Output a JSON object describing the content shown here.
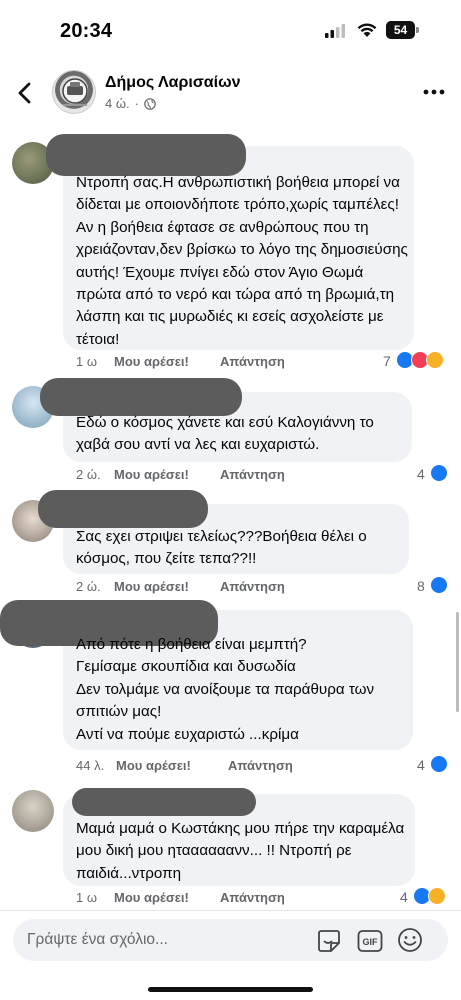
{
  "status_bar": {
    "time": "20:34",
    "battery": "54",
    "battery_level": 0.54
  },
  "header": {
    "page_name": "Δήμος Λαρισαίων",
    "post_age": "4 ώ."
  },
  "comments": [
    {
      "text": "Ντροπή σας.Η ανθρωπιστική βοήθεια μπορεί να δίδεται με οποιονδήποτε τρόπο,χωρίς ταμπέλες! Αν η βοήθεια έφτασε σε ανθρώπους που τη χρειάζονταν,δεν βρίσκω το λόγο της δημοσιεύσης αυτής! Έχουμε πνίγει εδώ στον Άγιο Θωμά πρώτα από το νερό και τώρα από τη βρωμιά,τη λάσπη και τις μυρωδιές κι εσείς ασχολείστε με τέτοια!",
      "time": "1 ω",
      "like": "Μου αρέσει!",
      "reply": "Απάντηση",
      "reactions": "7",
      "reaction_types": [
        "like",
        "love",
        "care"
      ]
    },
    {
      "text": "Εδώ ο κόσμος χάνετε και εσύ Καλογιάννη το χαβά σου αντί να λες και ευχαριστώ.",
      "time": "2 ώ.",
      "like": "Μου αρέσει!",
      "reply": "Απάντηση",
      "reactions": "4",
      "reaction_types": [
        "like"
      ]
    },
    {
      "text": "Σας εχει στριψει τελείως???Βοήθεια θέλει ο κόσμος, που ζείτε τεπα??!!",
      "time": "2 ώ.",
      "like": "Μου αρέσει!",
      "reply": "Απάντηση",
      "reactions": "8",
      "reaction_types": [
        "like"
      ]
    },
    {
      "text": "Από πότε η βοήθεια είναι μεμπτή?\nΓεμίσαμε σκουπίδια και δυσωδία\nΔεν τολμάμε να ανοίξουμε τα παράθυρα των σπιτιών μας!\nΑντί να πούμε ευχαριστώ ...κρίμα",
      "time": "44 λ.",
      "like": "Μου αρέσει!",
      "reply": "Απάντηση",
      "reactions": "4",
      "reaction_types": [
        "like"
      ]
    },
    {
      "text": "Μαμά μαμά ο Κωστάκης μου πήρε την καραμέλα μου δική μου ηταααααανν... !! Ντροπή ρε παιδιά...ντροπη",
      "time": "1 ω",
      "like": "Μου αρέσει!",
      "reply": "Απάντηση",
      "reactions": "4",
      "reaction_types": [
        "like",
        "haha"
      ]
    }
  ],
  "composer": {
    "placeholder": "Γράψτε ένα σχόλιο...",
    "gif_label": "GIF"
  },
  "colors": {
    "accent": "#1877f2",
    "bubble": "#f0f2f5",
    "meta_text": "#65676b",
    "redaction": "#5c5c5c"
  },
  "icons": [
    "back-arrow-icon",
    "globe-icon",
    "more-icon",
    "signal-icon",
    "wifi-icon",
    "sticker-icon",
    "gif-icon",
    "emoji-icon"
  ]
}
